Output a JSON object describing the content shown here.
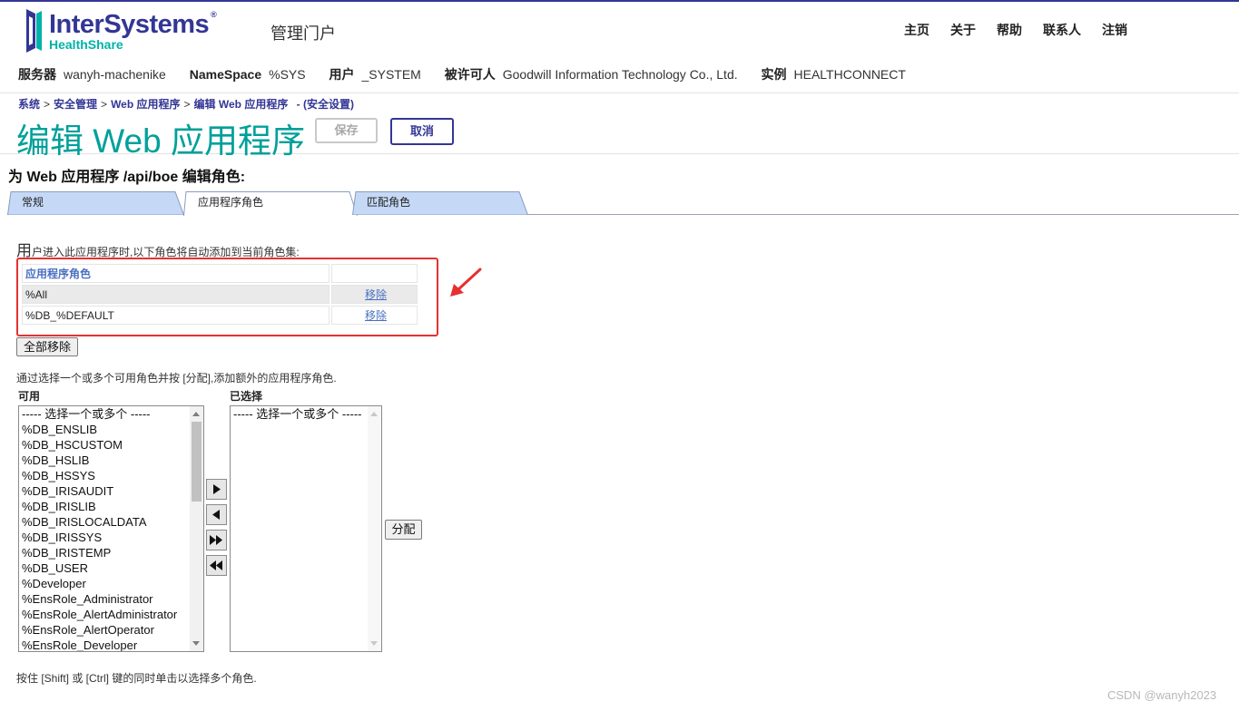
{
  "header": {
    "brand_name": "InterSystems",
    "brand_mark": "®",
    "brand_sub": "HealthShare",
    "portal_title": "管理门户",
    "nav": [
      "主页",
      "关于",
      "帮助",
      "联系人",
      "注销"
    ]
  },
  "info": {
    "server_label": "服务器",
    "server_value": "wanyh-machenike",
    "namespace_label": "NameSpace",
    "namespace_value": "%SYS",
    "user_label": "用户",
    "user_value": "_SYSTEM",
    "licensee_label": "被许可人",
    "licensee_value": "Goodwill Information Technology Co., Ltd.",
    "instance_label": "实例",
    "instance_value": "HEALTHCONNECT"
  },
  "breadcrumb": {
    "items": [
      "系统",
      "安全管理",
      "Web 应用程序",
      "编辑 Web 应用程序"
    ],
    "suffix": "- (安全设置)"
  },
  "page": {
    "title": "编辑 Web 应用程序",
    "save_label": "保存",
    "cancel_label": "取消",
    "section_title": "为 Web 应用程序 /api/boe 编辑角色:"
  },
  "tabs": [
    {
      "label": "常规",
      "active": false
    },
    {
      "label": "应用程序角色",
      "active": true
    },
    {
      "label": "匹配角色",
      "active": false
    }
  ],
  "roles": {
    "intro_big": "用",
    "intro_rest": "户进入此应用程序时,以下角色将自动添加到当前角色集:",
    "column_header": "应用程序角色",
    "rows": [
      {
        "name": "%All",
        "action": "移除"
      },
      {
        "name": "%DB_%DEFAULT",
        "action": "移除"
      }
    ],
    "remove_all_label": "全部移除"
  },
  "assign": {
    "hint": "通过选择一个或多个可用角色并按 [分配],添加额外的应用程序角色.",
    "available_label": "可用",
    "selected_label": "已选择",
    "available_options": [
      "----- 选择一个或多个 -----",
      "%DB_ENSLIB",
      "%DB_HSCUSTOM",
      "%DB_HSLIB",
      "%DB_HSSYS",
      "%DB_IRISAUDIT",
      "%DB_IRISLIB",
      "%DB_IRISLOCALDATA",
      "%DB_IRISSYS",
      "%DB_IRISTEMP",
      "%DB_USER",
      "%Developer",
      "%EnsRole_Administrator",
      "%EnsRole_AlertAdministrator",
      "%EnsRole_AlertOperator",
      "%EnsRole_Developer"
    ],
    "selected_options": [
      "----- 选择一个或多个 -----"
    ],
    "assign_label": "分配",
    "footer_hint": "按住 [Shift] 或 [Ctrl] 键的同时单击以选择多个角色."
  },
  "watermark": "CSDN @wanyh2023",
  "colors": {
    "brand": "#333695",
    "accent": "#00a09a",
    "tab_inactive": "#c5d9f7",
    "highlight": "#e63030"
  }
}
